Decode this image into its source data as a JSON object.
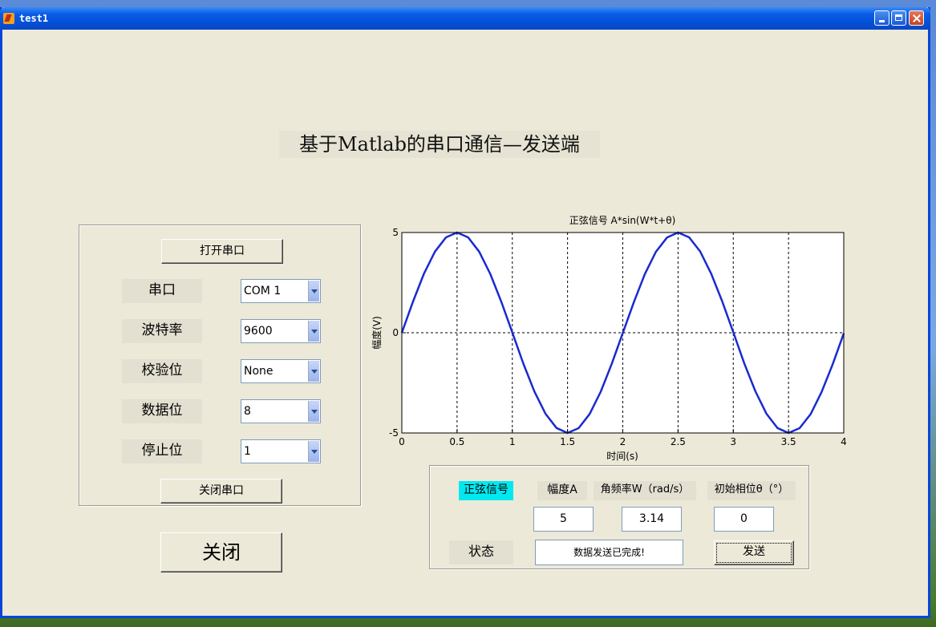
{
  "window": {
    "title": "test1"
  },
  "main_title": "基于Matlab的串口通信—发送端",
  "left_panel": {
    "open_button": "打开串口",
    "close_port_button": "关闭串口",
    "fields": [
      {
        "label": "串口",
        "value": "COM 1"
      },
      {
        "label": "波特率",
        "value": "9600"
      },
      {
        "label": "校验位",
        "value": "None"
      },
      {
        "label": "数据位",
        "value": "8"
      },
      {
        "label": "停止位",
        "value": "1"
      }
    ]
  },
  "close_button": "关闭",
  "bottom_panel": {
    "signal_label": "正弦信号",
    "amplitude_label": "幅度A",
    "freq_label": "角频率W（rad/s）",
    "phase_label": "初始相位θ（°）",
    "amplitude_value": "5",
    "freq_value": "3.14",
    "phase_value": "0",
    "status_label": "状态",
    "status_value": "数据发送已完成!",
    "send_button": "发送"
  },
  "chart_data": {
    "type": "line",
    "title": "正弦信号 A*sin(W*t+θ)",
    "xlabel": "时间(s)",
    "ylabel": "幅度(V)",
    "xlim": [
      0,
      4
    ],
    "ylim": [
      -5,
      5
    ],
    "xticks": [
      "0",
      "0.5",
      "1",
      "1.5",
      "2",
      "2.5",
      "3",
      "3.5",
      "4"
    ],
    "yticks": [
      "5",
      "0",
      "-5"
    ],
    "grid": true,
    "series": [
      {
        "color": "#1a2ad0",
        "x": [
          0,
          0.1,
          0.2,
          0.3,
          0.4,
          0.5,
          0.6,
          0.7,
          0.8,
          0.9,
          1.0,
          1.1,
          1.2,
          1.3,
          1.4,
          1.5,
          1.6,
          1.7,
          1.8,
          1.9,
          2.0,
          2.1,
          2.2,
          2.3,
          2.4,
          2.5,
          2.6,
          2.7,
          2.8,
          2.9,
          3.0,
          3.1,
          3.2,
          3.3,
          3.4,
          3.5,
          3.6,
          3.7,
          3.8,
          3.9,
          4.0
        ],
        "y": [
          0,
          1.54,
          2.94,
          4.05,
          4.76,
          5.0,
          4.76,
          4.05,
          2.94,
          1.55,
          0.01,
          -1.54,
          -2.93,
          -4.04,
          -4.75,
          -5.0,
          -4.76,
          -4.05,
          -2.94,
          -1.55,
          -0.01,
          1.53,
          2.93,
          4.04,
          4.75,
          5.0,
          4.76,
          4.06,
          2.95,
          1.56,
          0.02,
          -1.53,
          -2.92,
          -4.04,
          -4.75,
          -5.0,
          -4.76,
          -4.06,
          -2.95,
          -1.57,
          -0.03
        ]
      }
    ]
  }
}
